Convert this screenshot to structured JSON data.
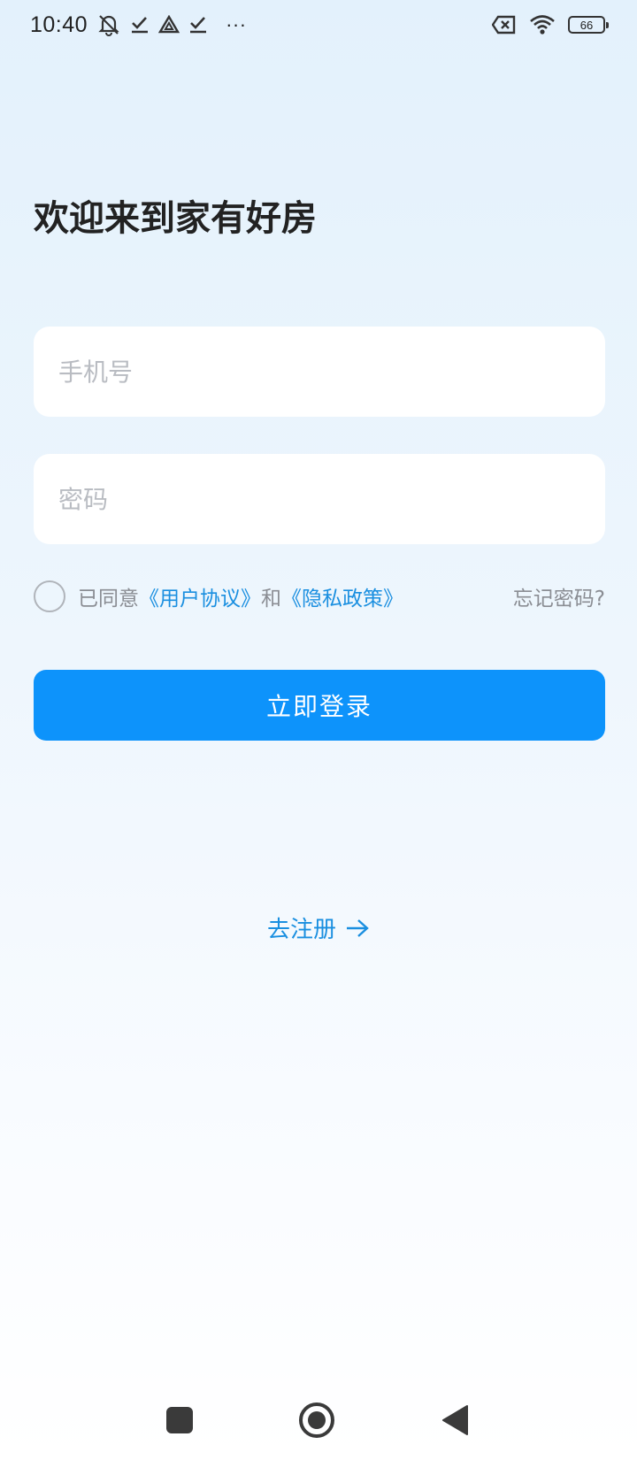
{
  "status_bar": {
    "time": "10:40",
    "more": "···",
    "battery": "66",
    "icons": [
      "mute-bell-icon",
      "check-download-icon",
      "drive-icon",
      "check-download-icon",
      "sim-off-icon",
      "wifi-icon",
      "battery-icon"
    ]
  },
  "welcome": {
    "title": "欢迎来到家有好房"
  },
  "form": {
    "phone_placeholder": "手机号",
    "password_placeholder": "密码",
    "agree_prefix": "已同意",
    "user_agreement": "《用户协议》",
    "and": "和",
    "privacy_policy": "《隐私政策》",
    "forgot_password": "忘记密码?",
    "login_button": "立即登录"
  },
  "register": {
    "label": "去注册"
  },
  "colors": {
    "accent": "#0d93fb",
    "link": "#1a8fe0",
    "background_top": "#e3f1fc"
  }
}
